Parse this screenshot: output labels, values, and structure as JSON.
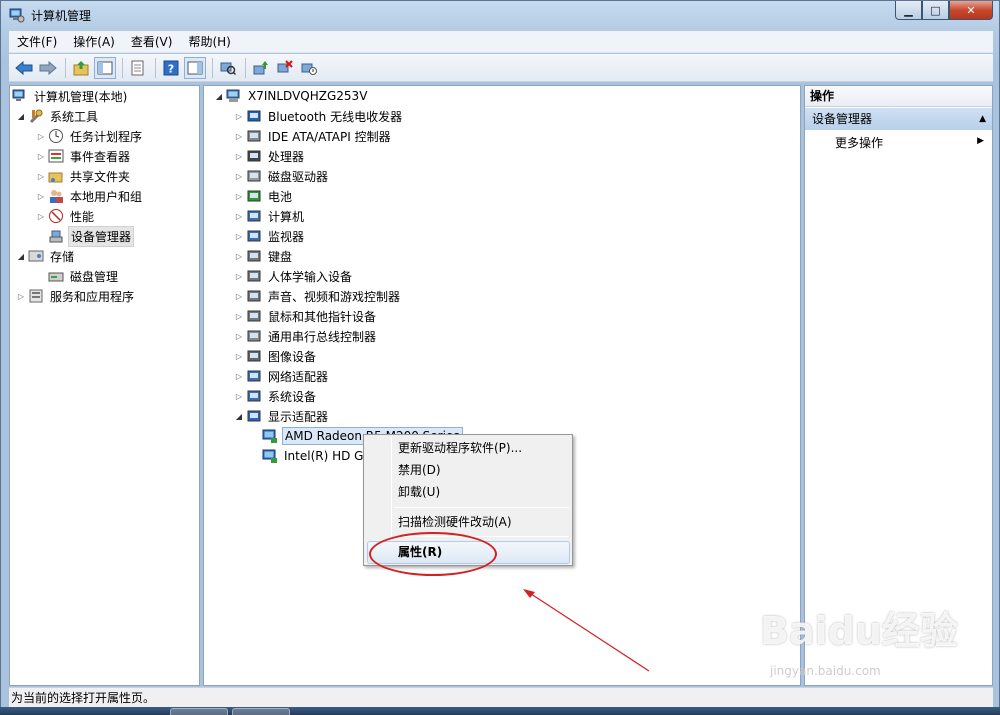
{
  "window": {
    "title": "计算机管理"
  },
  "menu": [
    "文件(F)",
    "操作(A)",
    "查看(V)",
    "帮助(H)"
  ],
  "left_tree": {
    "root": "计算机管理(本地)",
    "system_tools": "系统工具",
    "system_children": [
      "任务计划程序",
      "事件查看器",
      "共享文件夹",
      "本地用户和组",
      "性能",
      "设备管理器"
    ],
    "storage": "存储",
    "storage_children": [
      "磁盘管理"
    ],
    "services": "服务和应用程序"
  },
  "device_tree": {
    "computer_name": "X7INLDVQHZG253V",
    "categories": [
      "Bluetooth 无线电收发器",
      "IDE ATA/ATAPI 控制器",
      "处理器",
      "磁盘驱动器",
      "电池",
      "计算机",
      "监视器",
      "键盘",
      "人体学输入设备",
      "声音、视频和游戏控制器",
      "鼠标和其他指针设备",
      "通用串行总线控制器",
      "图像设备",
      "网络适配器",
      "系统设备",
      "显示适配器"
    ],
    "display_children": [
      "AMD Radeon R5 M200 Series",
      "Intel(R) HD Gr"
    ]
  },
  "context_menu": {
    "items": [
      "更新驱动程序软件(P)...",
      "禁用(D)",
      "卸载(U)",
      "扫描检测硬件改动(A)",
      "属性(R)"
    ]
  },
  "actions_pane": {
    "header": "操作",
    "section": "设备管理器",
    "more": "更多操作"
  },
  "status": "为当前的选择打开属性页。",
  "watermark": {
    "text": "Baidu经验",
    "sub": "jingyan.baidu.com"
  },
  "colors": {
    "annotation": "#d42020",
    "selection": "#dbe8f7"
  }
}
